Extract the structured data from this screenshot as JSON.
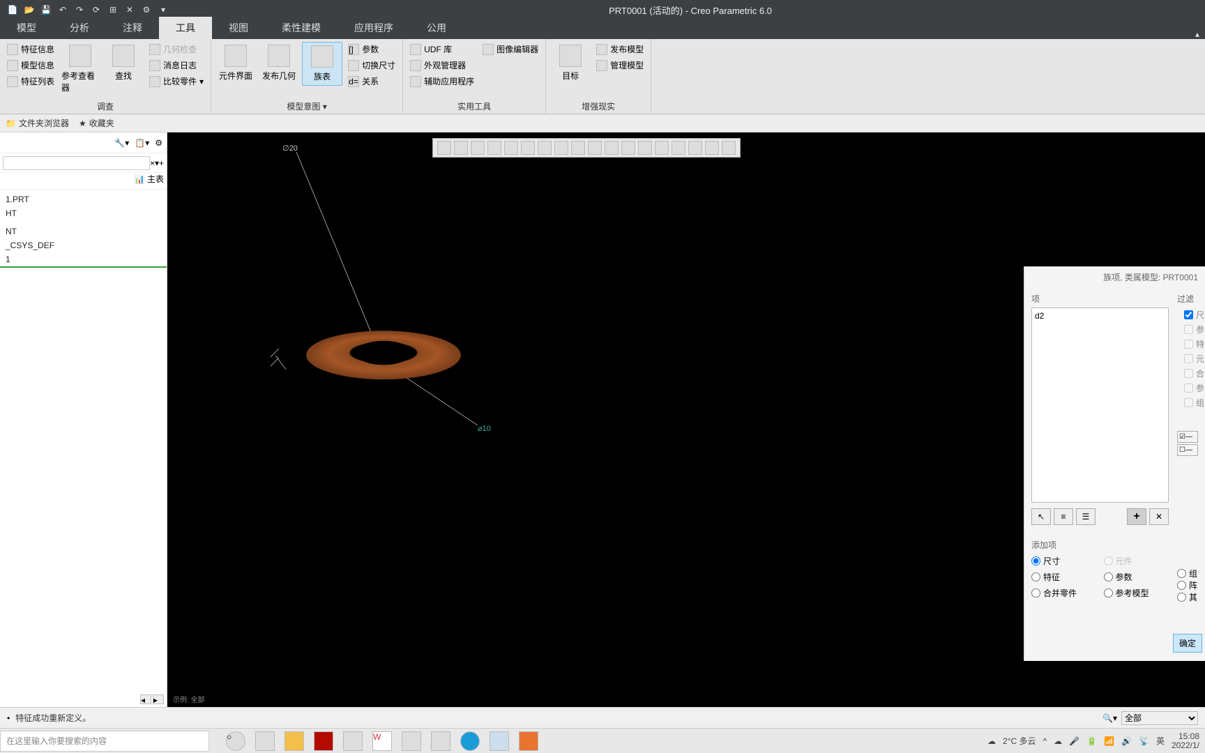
{
  "app": {
    "title": "PRT0001 (活动的) - Creo Parametric 6.0"
  },
  "tabs": {
    "model": "模型",
    "analysis": "分析",
    "annotate": "注释",
    "tools": "工具",
    "view": "视图",
    "flex": "柔性建模",
    "apps": "应用程序",
    "common": "公用"
  },
  "ribbon": {
    "group1": {
      "feature_info": "特征信息",
      "model_info": "模型信息",
      "feature_list": "特征列表",
      "ref_viewer": "参考查看器",
      "find": "查找",
      "geom_check": "几何检查",
      "msg_log": "消息日志",
      "compare_parts": "比较零件",
      "label": "调查"
    },
    "group2": {
      "component_if": "元件界面",
      "publish_geom": "发布几何",
      "family_table": "族表",
      "params": "参数",
      "switch_dims": "切换尺寸",
      "relations": "关系",
      "label": "模型意图"
    },
    "group3": {
      "udf_lib": "UDF 库",
      "appearance_mgr": "外观管理器",
      "aux_app": "辅助应用程序",
      "image_editor": "图像编辑器",
      "label": "实用工具"
    },
    "group4": {
      "target": "目标",
      "publish_model": "发布模型",
      "manage_model": "管理模型",
      "label": "增强现实"
    }
  },
  "nav": {
    "folder_browser": "文件夹浏览器",
    "favorites": "收藏夹",
    "main_table": "主表"
  },
  "tree": {
    "items": [
      "1.PRT",
      "HT",
      "",
      "NT",
      "_CSYS_DEF",
      "1"
    ]
  },
  "viewport": {
    "dim1": "∅20",
    "dim2": "⌀10",
    "status": "示例: 全部"
  },
  "dialog": {
    "title": "族项,  类属模型: PRT0001",
    "section_items": "项",
    "list_item": "d2",
    "section_add": "添加项",
    "radios": {
      "dim": "尺寸",
      "comp": "元件",
      "group": "组",
      "feat": "特征",
      "param": "参数",
      "array": "阵",
      "merge": "合并零件",
      "refmodel": "参考模型",
      "other": "其"
    },
    "ok": "确定"
  },
  "filter": {
    "label": "过滤",
    "items": [
      "尺",
      "参",
      "特",
      "元",
      "合",
      "参",
      "组"
    ]
  },
  "status": {
    "msg": "特征成功重新定义。",
    "filter": "全部"
  },
  "taskbar": {
    "search_placeholder": "在这里输入你要搜索的内容",
    "weather": "2°C 多云",
    "ime": "英",
    "time": "15:08",
    "date": "2022/1/"
  }
}
